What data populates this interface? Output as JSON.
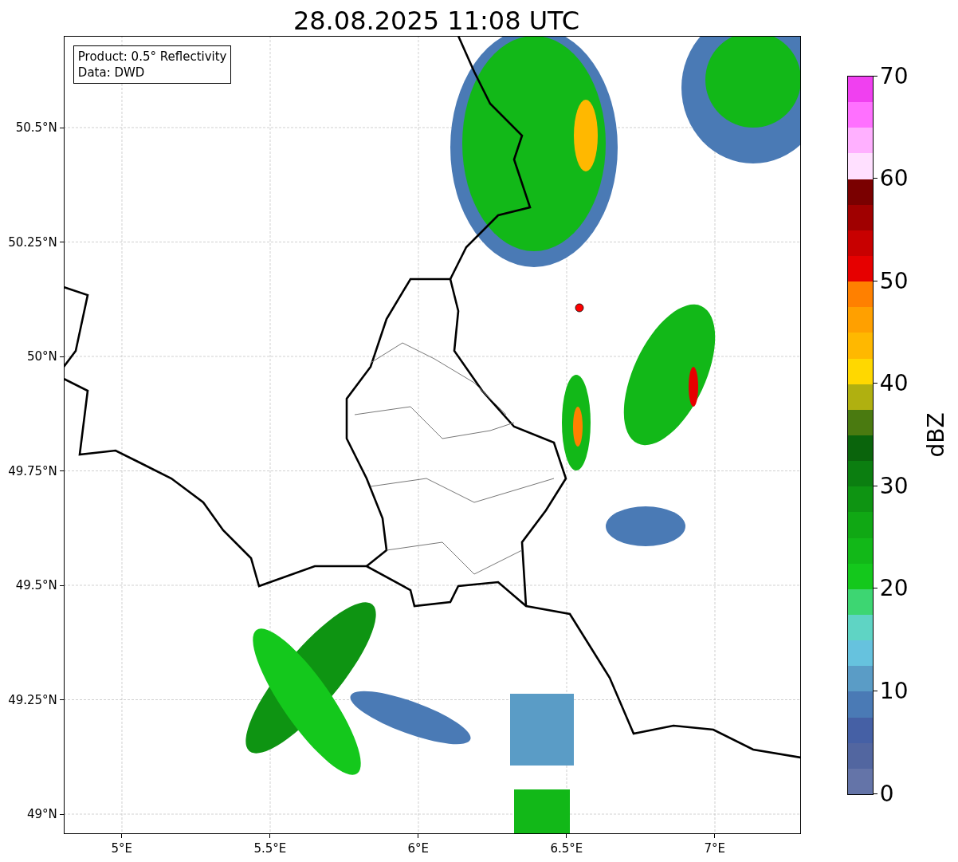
{
  "title": "28.08.2025 11:08 UTC",
  "map": {
    "info": [
      "Product: 0.5° Reflectivity",
      "Data: DWD"
    ],
    "y_ticks": [
      "50.5°N",
      "50.25°N",
      "50°N",
      "49.75°N",
      "49.5°N",
      "49.25°N",
      "49°N"
    ],
    "x_ticks": [
      "5°E",
      "5.5°E",
      "6°E",
      "6.5°E",
      "7°E"
    ]
  },
  "colorbar": {
    "label": "dBZ",
    "ticks": [
      "70",
      "60",
      "50",
      "40",
      "30",
      "20",
      "10",
      "0"
    ],
    "bands": [
      {
        "color": "#f040f0"
      },
      {
        "color": "#ff70ff"
      },
      {
        "color": "#ffb0ff"
      },
      {
        "color": "#ffe0ff"
      },
      {
        "color": "#7a0000"
      },
      {
        "color": "#a00000"
      },
      {
        "color": "#c80000"
      },
      {
        "color": "#e60000"
      },
      {
        "color": "#ff8000"
      },
      {
        "color": "#ffa000"
      },
      {
        "color": "#ffb800"
      },
      {
        "color": "#ffd800"
      },
      {
        "color": "#b0b010"
      },
      {
        "color": "#4a7a10"
      },
      {
        "color": "#0a640c"
      },
      {
        "color": "#0b7e10"
      },
      {
        "color": "#0e9412"
      },
      {
        "color": "#10a814"
      },
      {
        "color": "#12b818"
      },
      {
        "color": "#14c81c"
      },
      {
        "color": "#3dd672"
      },
      {
        "color": "#5fd4c4"
      },
      {
        "color": "#66c2de"
      },
      {
        "color": "#5a9cc6"
      },
      {
        "color": "#4a7ab5"
      },
      {
        "color": "#4560a5"
      },
      {
        "color": "#5266a0"
      },
      {
        "color": "#6474a8"
      }
    ]
  }
}
